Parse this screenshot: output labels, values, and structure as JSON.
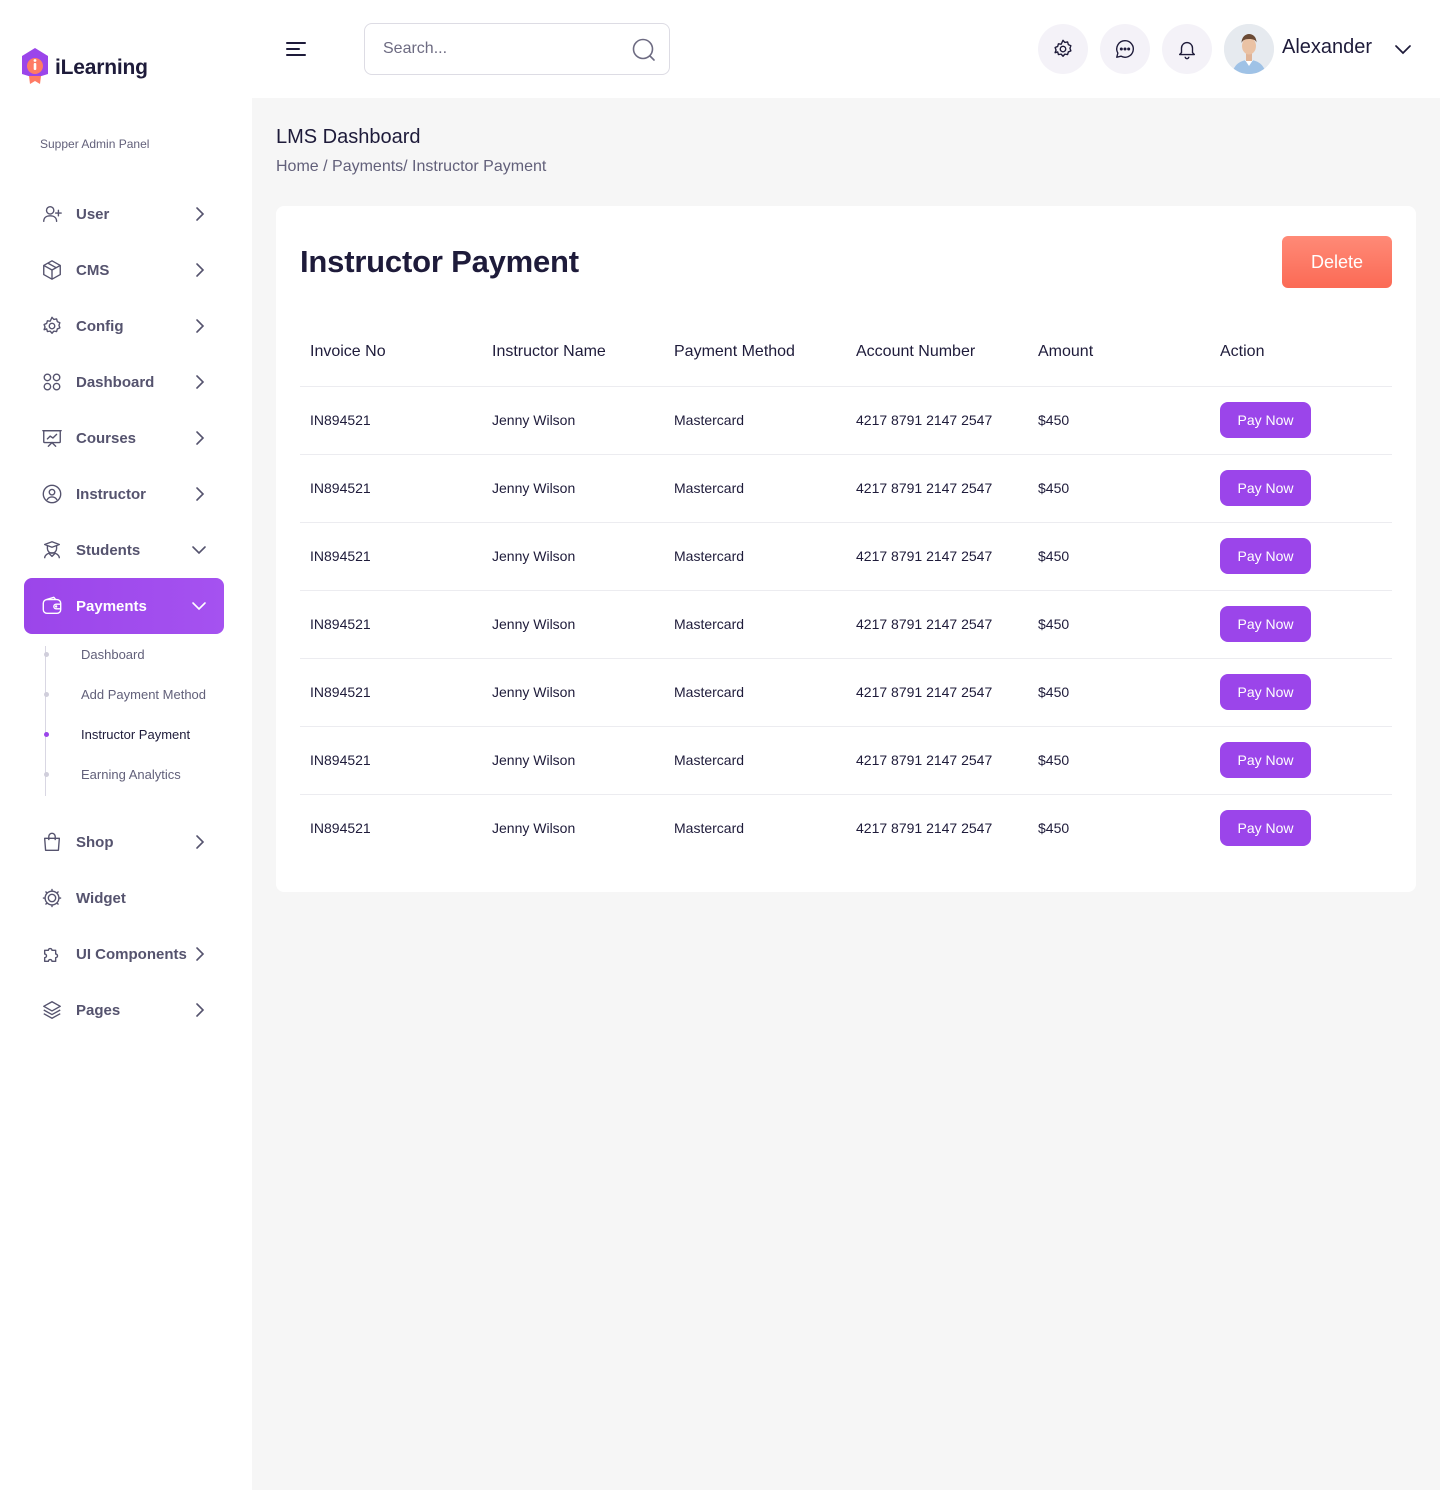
{
  "brand": {
    "name": "iLearning"
  },
  "sidebar": {
    "panel_label": "Supper Admin Panel",
    "items": [
      {
        "label": "User",
        "icon": "user-plus-icon",
        "chevron": "right"
      },
      {
        "label": "CMS",
        "icon": "cube-icon",
        "chevron": "right"
      },
      {
        "label": "Config",
        "icon": "gear-icon",
        "chevron": "right"
      },
      {
        "label": "Dashboard",
        "icon": "grid-icon",
        "chevron": "right"
      },
      {
        "label": "Courses",
        "icon": "presentation-chart-icon",
        "chevron": "right"
      },
      {
        "label": "Instructor",
        "icon": "user-circle-icon",
        "chevron": "right"
      },
      {
        "label": "Students",
        "icon": "student-icon",
        "chevron": "down"
      },
      {
        "label": "Payments",
        "icon": "wallet-icon",
        "chevron": "down",
        "active": true
      }
    ],
    "payments_sub": [
      {
        "label": "Dashboard"
      },
      {
        "label": "Add Payment Method"
      },
      {
        "label": "Instructor Payment",
        "current": true
      },
      {
        "label": "Earning Analytics"
      }
    ],
    "items_after": [
      {
        "label": "Shop",
        "icon": "shopping-bag-icon",
        "chevron": "right"
      },
      {
        "label": "Widget",
        "icon": "cog-wheel-icon",
        "chevron": "none"
      },
      {
        "label": "UI Components",
        "icon": "puzzle-icon",
        "chevron": "right"
      },
      {
        "label": "Pages",
        "icon": "layers-icon",
        "chevron": "right"
      }
    ]
  },
  "topbar": {
    "search_placeholder": "Search...",
    "user_name": "Alexander"
  },
  "page": {
    "title": "LMS Dashboard",
    "breadcrumb": "Home / Payments/ Instructor Payment"
  },
  "card": {
    "title": "Instructor Payment",
    "delete_label": "Delete",
    "columns": [
      "Invoice No",
      "Instructor Name",
      "Payment Method",
      "Account Number",
      "Amount",
      "Action"
    ],
    "rows": [
      {
        "invoice": "IN894521",
        "name": "Jenny Wilson",
        "method": "Mastercard",
        "account": "4217 8791 2147 2547",
        "amount": "$450",
        "action": "Pay Now"
      },
      {
        "invoice": "IN894521",
        "name": "Jenny Wilson",
        "method": "Mastercard",
        "account": "4217 8791 2147 2547",
        "amount": "$450",
        "action": "Pay Now"
      },
      {
        "invoice": "IN894521",
        "name": "Jenny Wilson",
        "method": "Mastercard",
        "account": "4217 8791 2147 2547",
        "amount": "$450",
        "action": "Pay Now"
      },
      {
        "invoice": "IN894521",
        "name": "Jenny Wilson",
        "method": "Mastercard",
        "account": "4217 8791 2147 2547",
        "amount": "$450",
        "action": "Pay Now"
      },
      {
        "invoice": "IN894521",
        "name": "Jenny Wilson",
        "method": "Mastercard",
        "account": "4217 8791 2147 2547",
        "amount": "$450",
        "action": "Pay Now"
      },
      {
        "invoice": "IN894521",
        "name": "Jenny Wilson",
        "method": "Mastercard",
        "account": "4217 8791 2147 2547",
        "amount": "$450",
        "action": "Pay Now"
      },
      {
        "invoice": "IN894521",
        "name": "Jenny Wilson",
        "method": "Mastercard",
        "account": "4217 8791 2147 2547",
        "amount": "$450",
        "action": "Pay Now"
      }
    ]
  },
  "colors": {
    "accent": "#9b45ea",
    "danger": "#fb6a55",
    "text": "#1e1b3a",
    "muted": "#62607a",
    "background": "#f6f6f6"
  }
}
